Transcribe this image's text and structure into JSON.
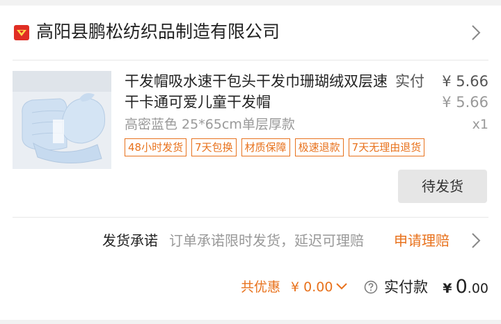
{
  "shop": {
    "name": "高阳县鹏松纺织品制造有限公司",
    "icon": "shop-icon",
    "accent": "#e02e24"
  },
  "item": {
    "title": "干发帽吸水速干包头干发巾珊瑚绒双层速干卡通可爱儿童干发帽",
    "paid_label": "实付",
    "paid_price": "¥ 5.66",
    "original_price": "¥ 5.66",
    "spec": "高密蓝色 25*65cm单层厚款",
    "quantity": "x1",
    "tags": [
      "48小时发货",
      "7天包换",
      "材质保障",
      "极速退款",
      "7天无理由退货"
    ],
    "status_button": "待发货"
  },
  "promise": {
    "label": "发货承诺",
    "text": "订单承诺限时发货，延迟可理赔",
    "link": "申请理赔"
  },
  "summary": {
    "discount_label": "共优惠",
    "discount_value": "¥ 0.00",
    "total_label": "实付款",
    "total_currency": "¥",
    "total_int": "0",
    "total_dec": ".00"
  },
  "colors": {
    "accent_orange": "#e8721d",
    "text_dark": "#222222",
    "text_gray": "#999999"
  }
}
